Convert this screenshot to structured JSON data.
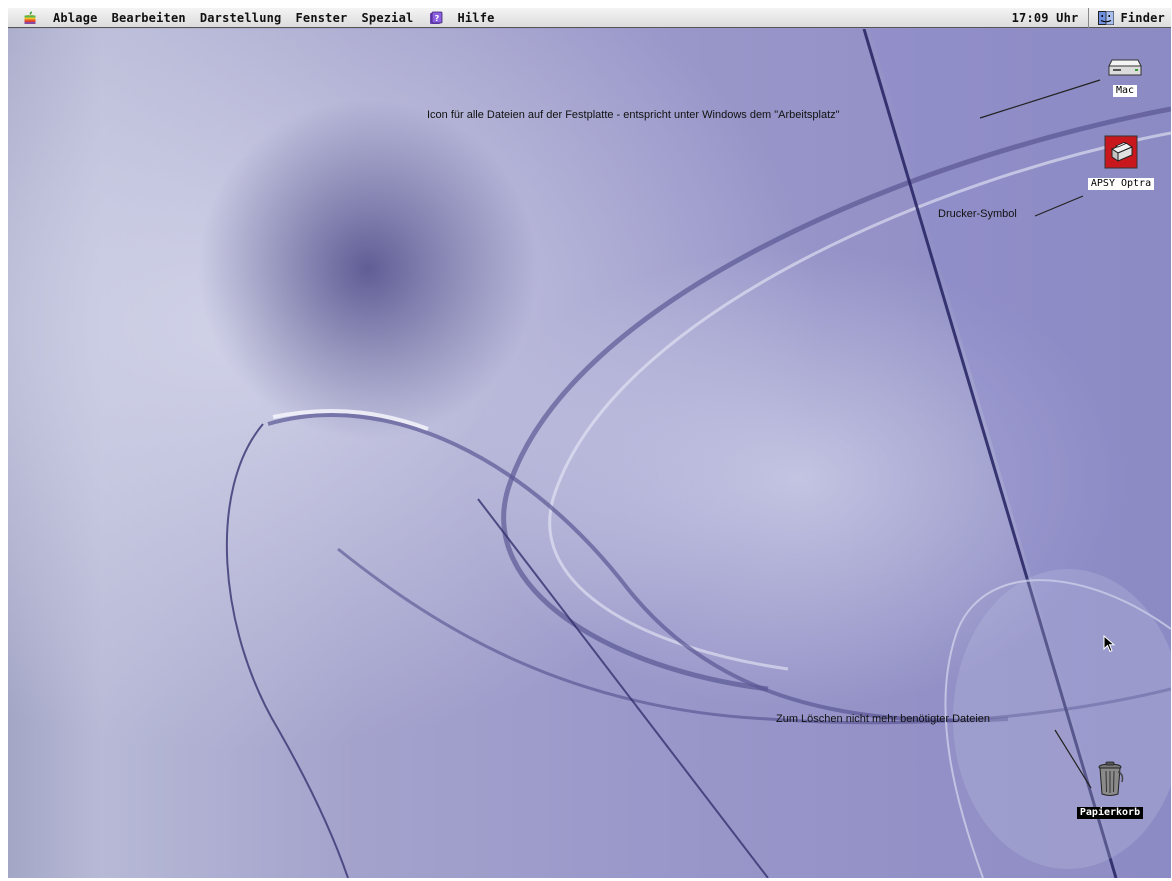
{
  "menubar": {
    "apple_icon": "apple-icon",
    "items": [
      "Ablage",
      "Bearbeiten",
      "Darstellung",
      "Fenster",
      "Spezial"
    ],
    "help_icon": "help-icon",
    "help_label": "Hilfe",
    "clock": "17:09 Uhr",
    "app_icon": "finder-icon",
    "app_name": "Finder"
  },
  "desktop": {
    "icons": [
      {
        "name": "hard-disk",
        "icon": "hard-disk-icon",
        "label": "Mac"
      },
      {
        "name": "printer",
        "icon": "printer-icon",
        "label": "APSY Optra"
      },
      {
        "name": "trash",
        "icon": "trash-icon",
        "label": "Papierkorb"
      }
    ],
    "annotations": {
      "hard_disk": "Icon für alle Dateien auf der Festplatte - entspricht unter Windows dem \"Arbeitsplatz\"",
      "printer": "Drucker-Symbol",
      "trash": "Zum Löschen nicht mehr benötigter Dateien"
    }
  },
  "colors": {
    "wallpaper_light": "#c3c5e0",
    "wallpaper_dark": "#4d4a86",
    "menubar": "#e6e6e6",
    "printer_icon_bg": "#c8181e"
  }
}
